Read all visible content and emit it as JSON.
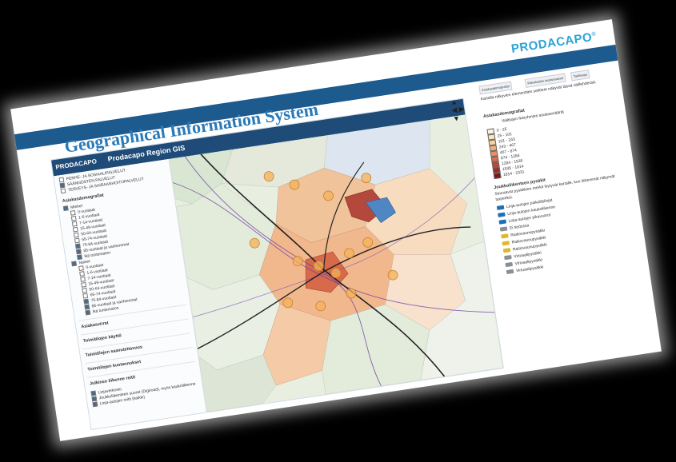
{
  "brand": "PRODACAPO",
  "headline": "Geographical Information System",
  "app": {
    "logo": "PRODACAPO",
    "title": "Prodacapo Region GIS"
  },
  "left": {
    "top_items": [
      {
        "label": "PERHE- JA SOSIAALIPALVELUT",
        "checked": false
      },
      {
        "label": "SÄÄNNÖSTEN PALVELUT",
        "checked": true
      },
      {
        "label": "TERVEYS- JA SAIRAANHOITOPALVELUT",
        "checked": false
      }
    ],
    "demography_title": "Asiakasdemografiat",
    "group_men": "Miehet",
    "men_ages": [
      {
        "label": "0-vuotiaat",
        "checked": false
      },
      {
        "label": "1-6-vuotiaat",
        "checked": false
      },
      {
        "label": "7-14-vuotiaat",
        "checked": false
      },
      {
        "label": "15-49-vuotiaat",
        "checked": false
      },
      {
        "label": "50-64-vuotiaat",
        "checked": false
      },
      {
        "label": "65-74-vuotiaat",
        "checked": false
      },
      {
        "label": "75-84-vuotiaat",
        "checked": true
      },
      {
        "label": "85-vuotiaat ja vanhemmat",
        "checked": true
      },
      {
        "label": "Ikä tuntematon",
        "checked": true
      }
    ],
    "group_women": "Naiset",
    "women_ages": [
      {
        "label": "0-vuotiaat",
        "checked": false
      },
      {
        "label": "1-6-vuotiaat",
        "checked": false
      },
      {
        "label": "7-14-vuotiaat",
        "checked": false
      },
      {
        "label": "15-49-vuotiaat",
        "checked": false
      },
      {
        "label": "50-64-vuotiaat",
        "checked": false
      },
      {
        "label": "65-74-vuotiaat",
        "checked": false
      },
      {
        "label": "75-84-vuotiaat",
        "checked": true
      },
      {
        "label": "85-vuotiaat ja vanhemmat",
        "checked": true
      },
      {
        "label": "Ikä tuntematon",
        "checked": true
      }
    ],
    "sections": [
      "Asiakasvirrat",
      "Toimitilojen käyttö",
      "Toimitilojen saavutettavuus",
      "Toimitilojen kustannukset",
      "Julkinen liikenne reitit"
    ],
    "bottom_items": [
      {
        "label": "Linjaverkosto",
        "checked": true
      },
      {
        "label": "Joukkoliikenteen suorat (Digiroad), myös kaukoliikenne",
        "checked": true
      },
      {
        "label": "Linja-autojen reitit (kaikki)",
        "checked": true
      }
    ]
  },
  "right": {
    "tabs": [
      "Asiakasdemografiat",
      "Palveluiden kustannukset",
      "Tarkkaaja"
    ],
    "info_text": "Kartalla näkyvien elementtien selitteet näkyvät tässä välilehdessä.",
    "legend1_title": "Asiakasdemografiat",
    "legend1_subtitle": "Valittujen ikäryhmien asukasmäärät",
    "legend1_items": [
      {
        "label": "0 - 25",
        "color": "#fdf6e6"
      },
      {
        "label": "25 - 101",
        "color": "#fbe6c0"
      },
      {
        "label": "101 - 243",
        "color": "#f8d3a0"
      },
      {
        "label": "243 - 467",
        "color": "#f3b07e"
      },
      {
        "label": "467 - 874",
        "color": "#ea8f62"
      },
      {
        "label": "874 - 1284",
        "color": "#dd6a48"
      },
      {
        "label": "1284 - 1535",
        "color": "#c24634"
      },
      {
        "label": "1535 - 1814",
        "color": "#a12a24"
      },
      {
        "label": "1814 - 2331",
        "color": "#7a1518"
      }
    ],
    "legend2_title": "Joukkoliikenteen pysäkit",
    "legend2_text": "Seuraavat pysäkkien merkit löytyvät kartalle, kun lähemmät näkymät tarpeeksi.",
    "legend2_items": [
      {
        "label": "Linja-autojen paikallislinjat",
        "icon": "bus-stop-icon"
      },
      {
        "label": "Linja-autojen kaukoliikenne",
        "icon": "bus-stop-icon"
      },
      {
        "label": "Linja-autojen pikavuorot",
        "icon": "bus-stop-icon"
      },
      {
        "label": "Ei tiedossa",
        "icon": "stop-icon"
      },
      {
        "label": "Raitiovaunupysäkki",
        "icon": "tram-stop-icon"
      },
      {
        "label": "Raitiovaunupysäkki",
        "icon": "tram-stop-icon"
      },
      {
        "label": "Raitiovaunupysäkki",
        "icon": "tram-stop-icon"
      },
      {
        "label": "Virtuaalipysäkki",
        "icon": "virtual-stop-icon"
      },
      {
        "label": "Virtuaalipysäkki",
        "icon": "virtual-stop-icon"
      },
      {
        "label": "Virtuaalipysäkki",
        "icon": "virtual-stop-icon"
      }
    ]
  },
  "colors": {
    "brand": "#29a3d7",
    "header": "#1f4b78",
    "bar": "#1d5a8e"
  }
}
